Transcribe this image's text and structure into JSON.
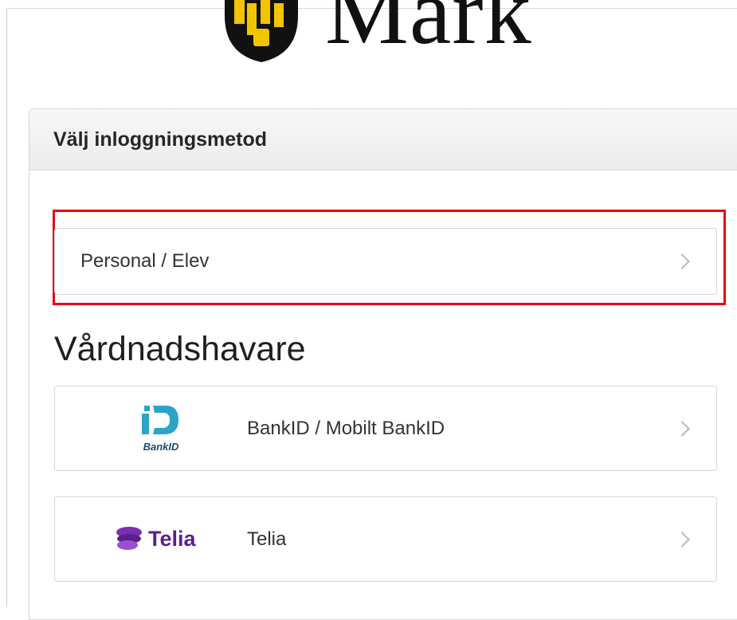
{
  "logo": {
    "wordmark": "Mark",
    "icon": "municipal-crest-icon"
  },
  "panel": {
    "title": "Välj inloggningsmetod"
  },
  "methods": {
    "personal": {
      "label": "Personal / Elev"
    }
  },
  "guardians": {
    "heading": "Vårdnadshavare",
    "items": [
      {
        "label": "BankID / Mobilt BankID",
        "logo_text": "BankID",
        "icon": "bankid-logo-icon"
      },
      {
        "label": "Telia",
        "logo_text": "Telia",
        "icon": "telia-logo-icon"
      }
    ]
  },
  "colors": {
    "highlight": "#e30613",
    "bankid": "#2aa4c8",
    "bankid_text": "#1a4c6e",
    "telia": "#5a1f8a"
  }
}
